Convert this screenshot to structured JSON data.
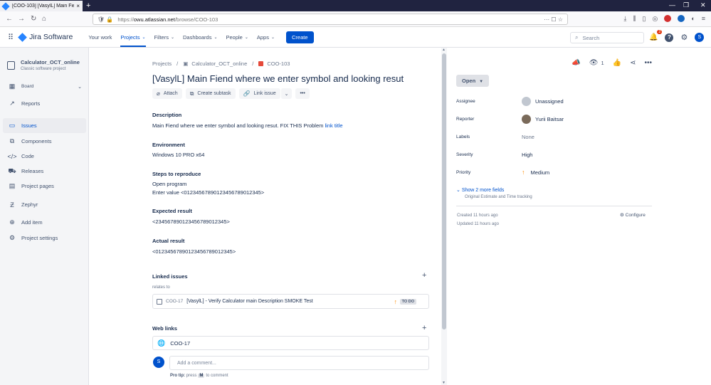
{
  "browser": {
    "tab_title": "[COO-103] [VasylL] Main Fiend",
    "url_scheme": "https://",
    "url_host": "owu.atlassian.net",
    "url_path": "/browse/COO-103"
  },
  "topnav": {
    "logo": "Jira Software",
    "menu": [
      {
        "label": "Your work",
        "dropdown": false
      },
      {
        "label": "Projects",
        "dropdown": true
      },
      {
        "label": "Filters",
        "dropdown": true
      },
      {
        "label": "Dashboards",
        "dropdown": true
      },
      {
        "label": "People",
        "dropdown": true
      },
      {
        "label": "Apps",
        "dropdown": true
      }
    ],
    "create_label": "Create",
    "search_placeholder": "Search",
    "notification_count": "2",
    "user_initial": "S"
  },
  "sidebar": {
    "project_name": "Calculator_OCT_online",
    "project_type": "Classic software project",
    "items": [
      {
        "label": "Board",
        "icon": "board-icon"
      },
      {
        "label": "Reports",
        "icon": "reports-icon"
      },
      {
        "label": "Issues",
        "icon": "issues-icon"
      },
      {
        "label": "Components",
        "icon": "components-icon"
      },
      {
        "label": "Code",
        "icon": "code-icon"
      },
      {
        "label": "Releases",
        "icon": "releases-icon"
      },
      {
        "label": "Project pages",
        "icon": "pages-icon"
      },
      {
        "label": "Zephyr",
        "icon": "zephyr-icon"
      },
      {
        "label": "Add item",
        "icon": "add-item-icon"
      },
      {
        "label": "Project settings",
        "icon": "settings-icon"
      }
    ]
  },
  "issue": {
    "breadcrumbs": [
      "Projects",
      "Calculator_OCT_online",
      "COO-103"
    ],
    "title": "[VasylL] Main Fiend where we enter symbol and looking resut",
    "actions": {
      "attach": "Attach",
      "subtask": "Create subtask",
      "link": "Link issue"
    },
    "description_h": "Description",
    "description": "Main Fiend where we enter symbol and looking resut. FIX THIS Problem",
    "description_link": "link title",
    "environment_h": "Environment",
    "environment": "Windows 10 PRO x64",
    "steps_h": "Steps to reproduce",
    "steps_1": "Open program",
    "steps_2": "Enter value <01234567890123456789012345>",
    "expected_h": "Expected result",
    "expected": "<234567890123456789012345>",
    "actual_h": "Actual result",
    "actual": "<01234567890123456789012345>",
    "linked_h": "Linked issues",
    "relates": "relates to",
    "linked_key": "COO-17",
    "linked_summary": "[VasylL] - Verify Calculator main Description SMOKE Test",
    "linked_status": "TO DO",
    "weblinks_h": "Web links",
    "weblink": "COO-17",
    "comment_avatar": "S",
    "comment_placeholder": "Add a comment...",
    "protip_label": "Pro tip:",
    "protip_press": "press",
    "protip_key": "M",
    "protip_to": "to comment"
  },
  "details": {
    "watch_count": "1",
    "status": "Open",
    "assignee_label": "Assignee",
    "assignee": "Unassigned",
    "reporter_label": "Reporter",
    "reporter": "Yurii Baitsar",
    "labels_label": "Labels",
    "labels": "None",
    "severity_label": "Severity",
    "severity": "High",
    "priority_label": "Priority",
    "priority": "Medium",
    "show_more": "Show 2 more fields",
    "show_more_sub": "Original Estimate and Time tracking",
    "created": "Created 11 hours ago",
    "updated": "Updated 11 hours ago",
    "configure": "Configure"
  }
}
